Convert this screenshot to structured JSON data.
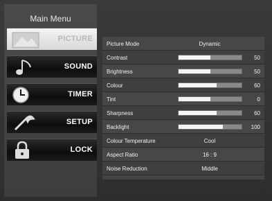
{
  "menu": {
    "title": "Main Menu",
    "items": [
      {
        "label": "PICTURE",
        "icon": "picture-icon",
        "active": true
      },
      {
        "label": "SOUND",
        "icon": "music-note-icon",
        "active": false
      },
      {
        "label": "TIMER",
        "icon": "clock-icon",
        "active": false
      },
      {
        "label": "SETUP",
        "icon": "wrench-icon",
        "active": false
      },
      {
        "label": "LOCK",
        "icon": "padlock-icon",
        "active": false
      }
    ]
  },
  "settings": [
    {
      "label": "Picture Mode",
      "value": "Dynamic"
    },
    {
      "label": "Contrast",
      "value": "50",
      "level": 50
    },
    {
      "label": "Brightness",
      "value": "50",
      "level": 50
    },
    {
      "label": "Colour",
      "value": "60",
      "level": 60
    },
    {
      "label": "Tint",
      "value": "0",
      "level": 50
    },
    {
      "label": "Sharpness",
      "value": "60",
      "level": 60
    },
    {
      "label": "Backlight",
      "value": "100",
      "level": 70
    },
    {
      "label": "Colour Temperature",
      "value": "Cool"
    },
    {
      "label": "Aspect Ratio",
      "value": "16 : 9"
    },
    {
      "label": "Noise Reduction",
      "value": "Middle"
    }
  ],
  "colors": {
    "background": "#2b2b2b",
    "panel": "#444444",
    "active_item": "#e6e6e6",
    "bar_fill": "#f5f5f5"
  }
}
